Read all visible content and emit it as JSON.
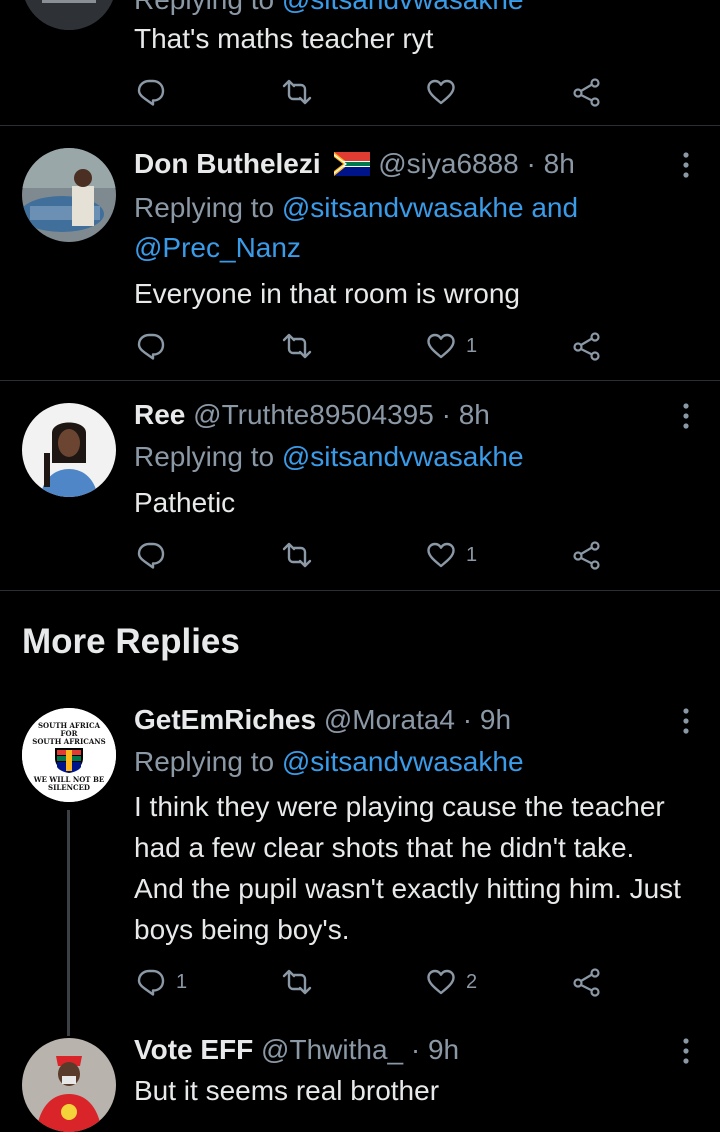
{
  "tweet0": {
    "replying_prefix": "Replying to",
    "replying_to": "@sitsandvwasakhe",
    "text": "That's maths teacher ryt"
  },
  "tweet1": {
    "name": "Don Buthelezi",
    "handle": "@siya6888",
    "time": "· 8h",
    "replying_prefix": "Replying to",
    "replying_to": "@sitsandvwasakhe",
    "replying_and": "and",
    "replying_to2": "@Prec_Nanz",
    "text": "Everyone in that room is wrong",
    "likes": "1"
  },
  "tweet2": {
    "name": "Ree",
    "handle": "@Truthte89504395",
    "time": "· 8h",
    "replying_prefix": "Replying to",
    "replying_to": "@sitsandvwasakhe",
    "text": "Pathetic",
    "likes": "1"
  },
  "section": {
    "title": "More Replies"
  },
  "tweet3": {
    "name": "GetEmRiches",
    "handle": "@Morata4",
    "time": "· 9h",
    "replying_prefix": "Replying to",
    "replying_to": "@sitsandvwasakhe",
    "text": "I think they were playing cause the teacher had a few clear shots that he didn't take. And the pupil wasn't exactly hitting him. Just boys being boy's.",
    "replies": "1",
    "likes": "2",
    "avatar_text": {
      "top": "SOUTH AFRICA",
      "mid": "FOR",
      "low": "SOUTH AFRICANS",
      "bottom1": "WE WILL NOT BE",
      "bottom2": "SILENCED"
    }
  },
  "tweet4": {
    "name": "Vote EFF",
    "handle": "@Thwitha_",
    "time": "· 9h",
    "text": "But it seems real brother"
  },
  "colors": {
    "background": "#000000",
    "link": "#3a9be8",
    "muted": "#8b98a5",
    "divider": "#2a2f33"
  }
}
